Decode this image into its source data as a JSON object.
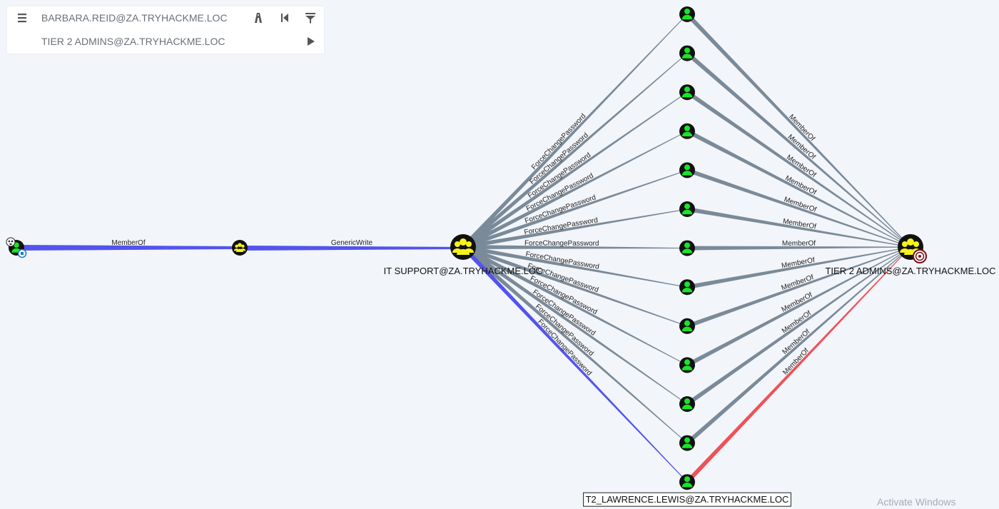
{
  "search_panel": {
    "start_node": "BARBARA.REID@ZA.TRYHACKME.LOC",
    "target_node": "TIER 2 ADMINS@ZA.TRYHACKME.LOC",
    "icons": [
      "menu-icon",
      "pathfinding-icon",
      "back-icon",
      "filter-icon",
      "play-icon"
    ]
  },
  "graph": {
    "nodes": {
      "start_user": {
        "label": "",
        "type": "user",
        "icons": [
          "skull-icon",
          "owned-icon"
        ]
      },
      "intermediate_group": {
        "label": "",
        "type": "group"
      },
      "it_support": {
        "label": "IT SUPPORT@ZA.TRYHACKME.LOC",
        "type": "group"
      },
      "tier2_admins": {
        "label": "TIER 2 ADMINS@ZA.TRYHACKME.LOC",
        "type": "group",
        "icons": [
          "target-icon"
        ]
      },
      "t2_users": [
        "",
        "",
        "",
        "",
        "",
        "",
        "",
        "",
        "",
        "",
        "",
        "",
        "T2_LAWRENCE.LEWIS@ZA.TRYHACKME.LOC"
      ]
    },
    "edges": {
      "start_to_group": "MemberOf",
      "group_to_it_support": "GenericWrite",
      "it_support_to_users": "ForceChangePassword",
      "users_to_tier2": "MemberOf"
    },
    "colors": {
      "highlight_path": "#5353ee",
      "final_edge": "#ee5257",
      "default_edge": "#7a8a98",
      "group_node": "#f6f21c",
      "user_node": "#17e625",
      "node_ring": "#111111"
    }
  },
  "watermark": "Activate Windows"
}
